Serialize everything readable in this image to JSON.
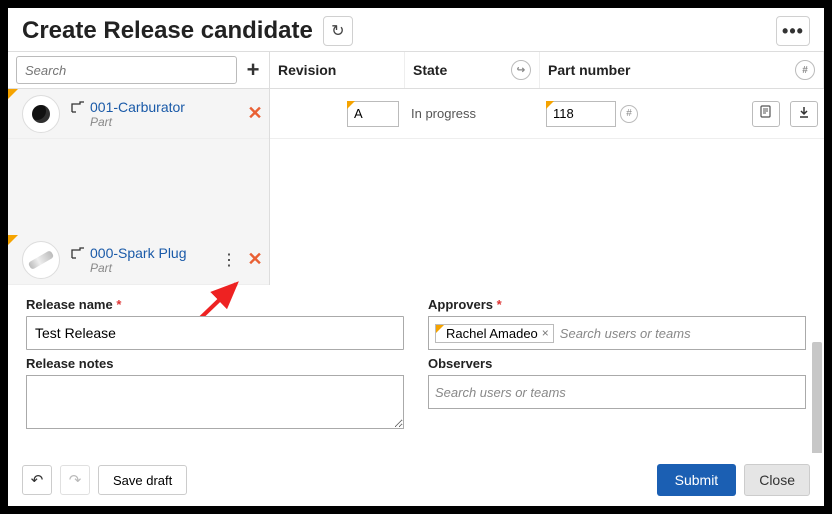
{
  "header": {
    "title": "Create Release candidate"
  },
  "parts": {
    "search_placeholder": "Search",
    "items": [
      {
        "name": "001-Carburator",
        "type": "Part"
      },
      {
        "name": "000-Spark Plug",
        "type": "Part"
      }
    ]
  },
  "table": {
    "headers": {
      "revision": "Revision",
      "state": "State",
      "part_number": "Part number"
    },
    "row": {
      "revision": "A",
      "state": "In progress",
      "part_number": "118"
    }
  },
  "form": {
    "release_name_label": "Release name",
    "release_name_value": "Test Release",
    "release_notes_label": "Release notes",
    "approvers_label": "Approvers",
    "approvers_chip": "Rachel Amadeo",
    "approvers_placeholder": "Search users or teams",
    "observers_label": "Observers",
    "observers_placeholder": "Search users or teams"
  },
  "footer": {
    "save_draft": "Save draft",
    "submit": "Submit",
    "close": "Close"
  }
}
